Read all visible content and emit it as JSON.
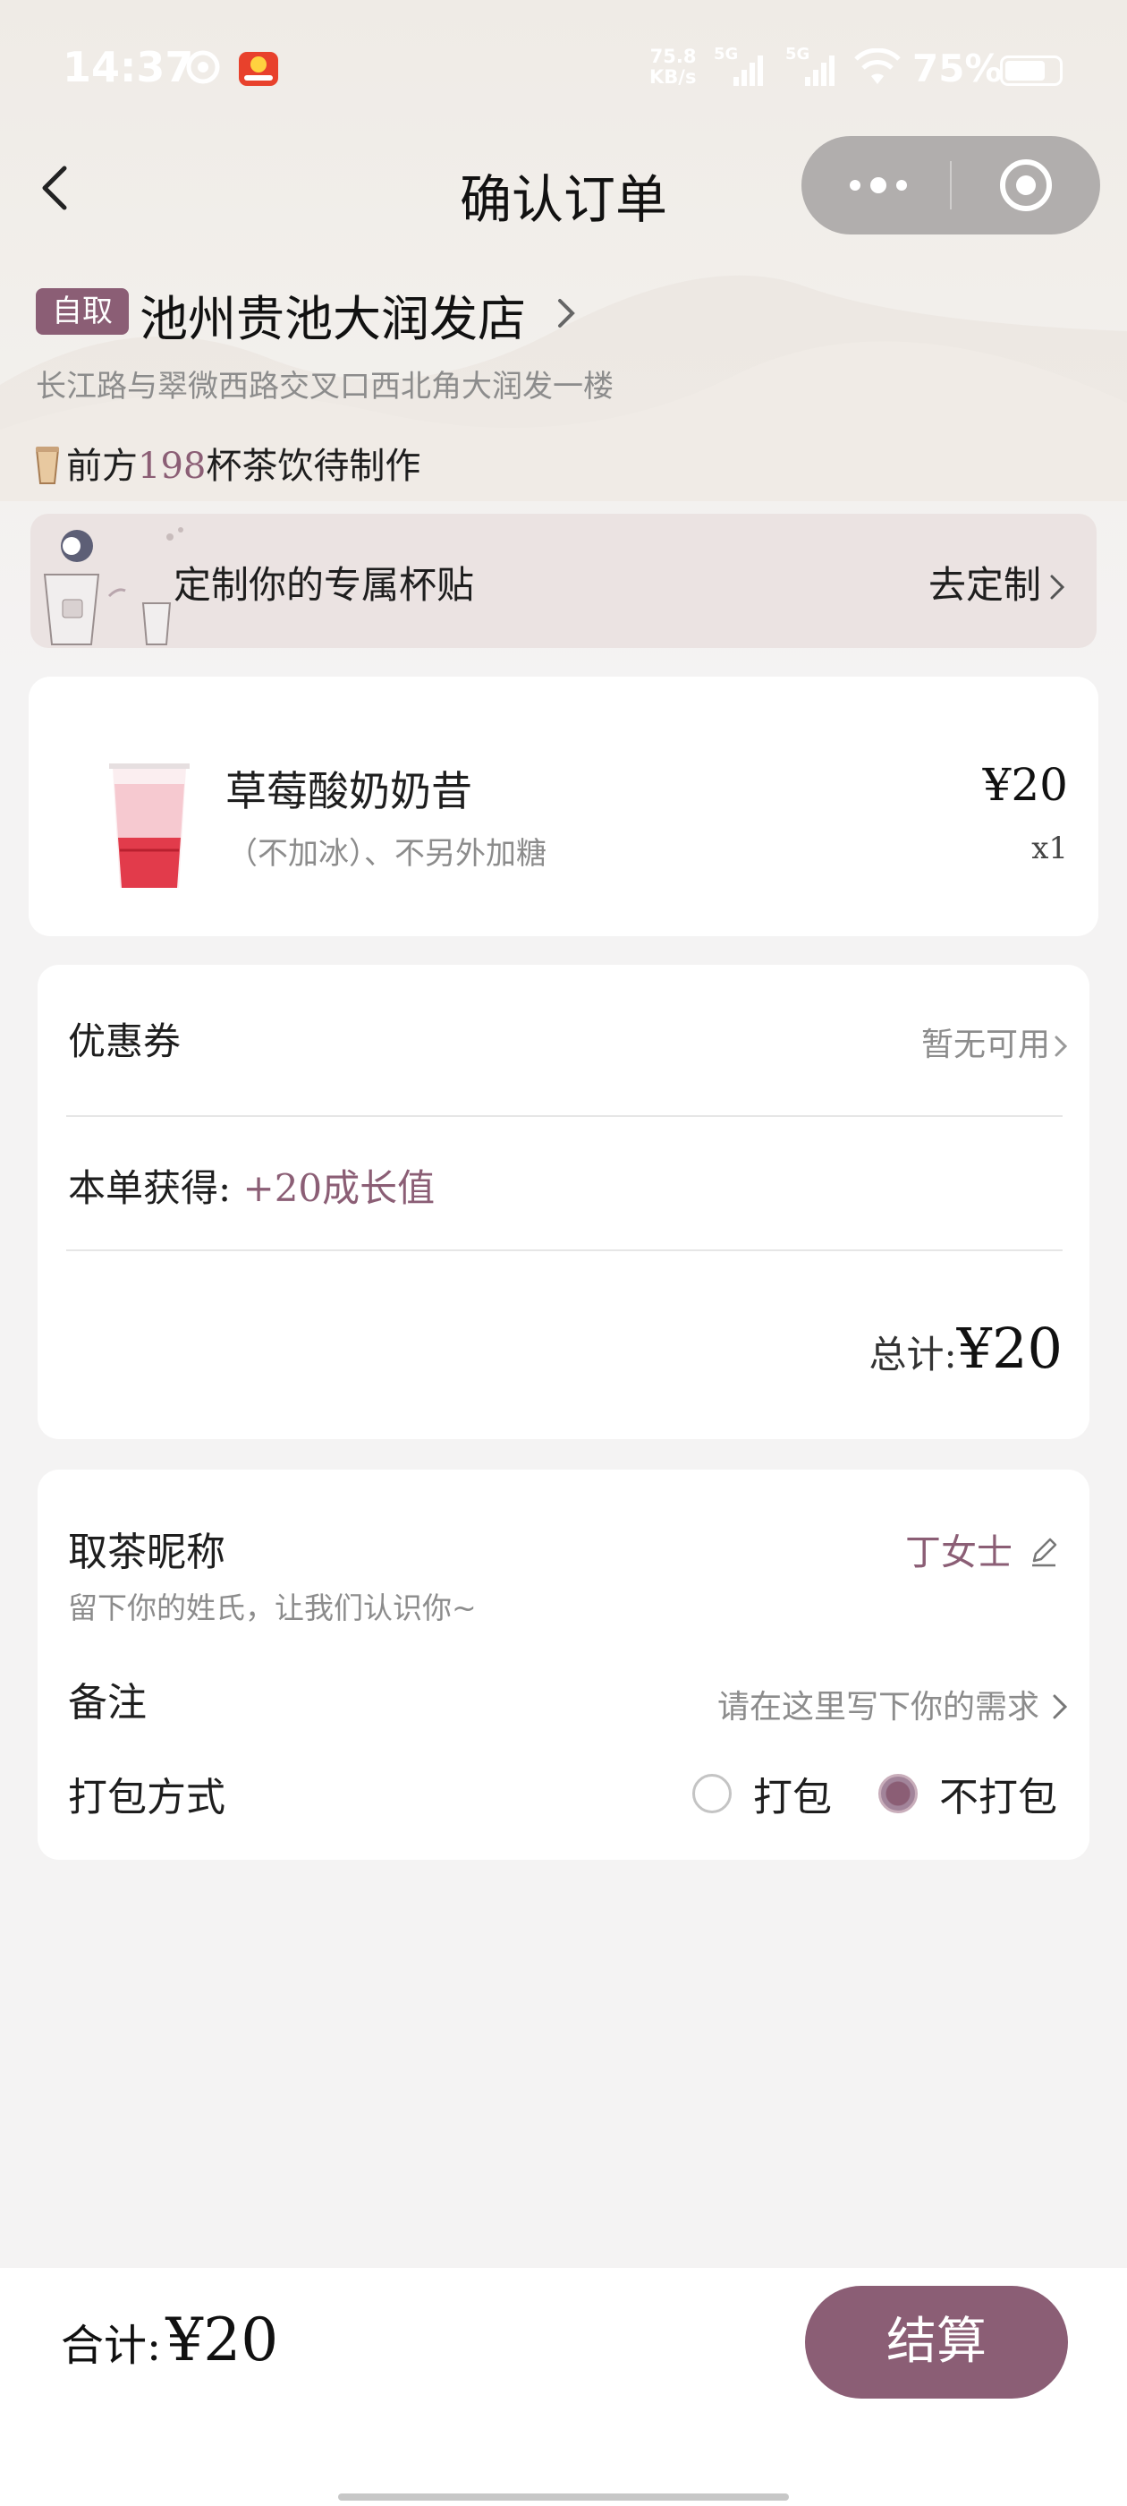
{
  "status_bar": {
    "time": "14:37",
    "net_speed_value": "75.8",
    "net_speed_unit": "KB/s",
    "signal_1": "5G",
    "signal_2": "5G",
    "battery_pct": "75%"
  },
  "nav": {
    "title": "确认订单"
  },
  "store": {
    "tag": "自取",
    "name": "池州贵池大润发店",
    "address": "长江路与翠微西路交叉口西北角大润发一楼",
    "queue_prefix": "前方",
    "queue_count": "198",
    "queue_suffix": "杯茶饮待制作"
  },
  "sticker_banner": {
    "text": "定制你的专属杯贴",
    "action": "去定制"
  },
  "product": {
    "name": "草莓酸奶奶昔",
    "spec": "（不加冰）、不另外加糖",
    "price": "¥20",
    "qty": "x1"
  },
  "discount": {
    "coupon_label": "优惠券",
    "coupon_value": "暂无可用",
    "earn_label": "本单获得:",
    "earn_value": "+20成长值",
    "total_label": "总计:",
    "total_value": "¥20"
  },
  "info": {
    "nick_label": "取茶昵称",
    "nick_hint": "留下你的姓氏，让我们认识你~",
    "nick_value": "丁女士",
    "remark_label": "备注",
    "remark_placeholder": "请在这里写下你的需求",
    "pack_label": "打包方式",
    "pack_options": [
      "打包",
      "不打包"
    ],
    "pack_selected": "不打包"
  },
  "bottom": {
    "sum_label": "合计:",
    "sum_value": "¥20",
    "checkout_label": "结算"
  },
  "colors": {
    "accent": "#8b5e75",
    "muted_text": "#8c8c8c",
    "page_bg": "#f4f3f3"
  }
}
